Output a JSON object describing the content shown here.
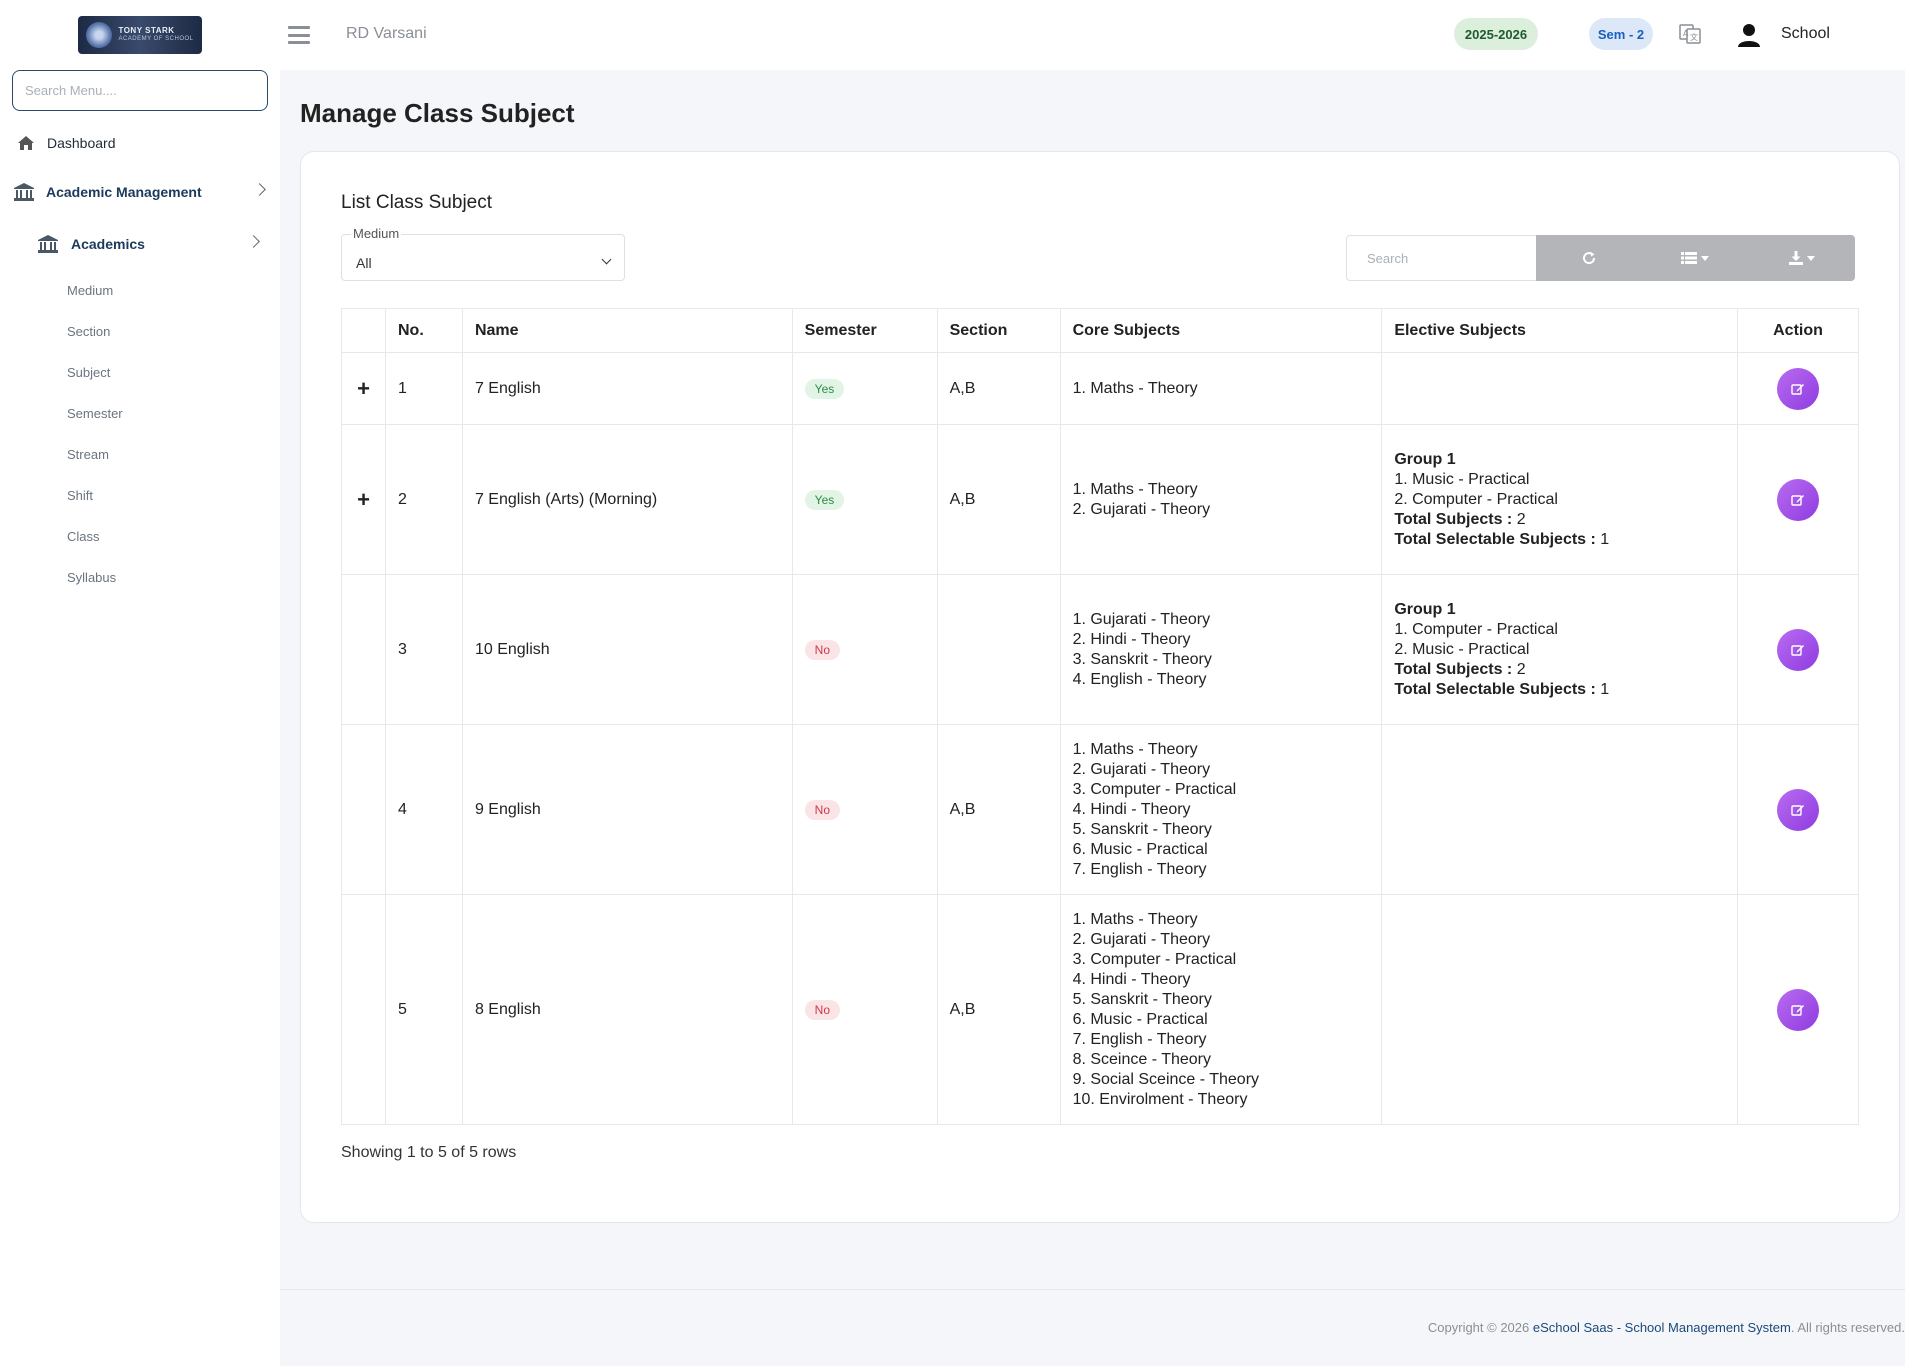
{
  "sidebar": {
    "logo_line1": "TONY STARK",
    "logo_line2": "ACADEMY OF SCHOOL",
    "search_placeholder": "Search Menu....",
    "items": [
      {
        "label": "Dashboard",
        "icon": "home-icon"
      },
      {
        "label": "Academic Management",
        "icon": "bank-icon"
      },
      {
        "label": "Academics",
        "icon": "bank-icon"
      }
    ],
    "sub_items": [
      "Medium",
      "Section",
      "Subject",
      "Semester",
      "Stream",
      "Shift",
      "Class",
      "Syllabus"
    ]
  },
  "topbar": {
    "school_name": "RD Varsani",
    "session": "2025-2026",
    "semester": "Sem - 2",
    "user_label": "School"
  },
  "page": {
    "title": "Manage Class Subject",
    "card_title": "List Class Subject",
    "medium_label": "Medium",
    "medium_value": "All",
    "search_placeholder": "Search",
    "showing": "Showing 1 to 5 of 5 rows"
  },
  "table": {
    "headers": [
      "",
      "No.",
      "Name",
      "Semester",
      "Section",
      "Core Subjects",
      "Elective Subjects",
      "Action"
    ],
    "rows": [
      {
        "expand": "+",
        "no": "1",
        "name": "7 English",
        "semester": "Yes",
        "section": "A,B",
        "core": [
          "1. Maths - Theory"
        ],
        "elective": []
      },
      {
        "expand": "+",
        "no": "2",
        "name": "7 English (Arts) (Morning)",
        "semester": "Yes",
        "section": "A,B",
        "core": [
          "1. Maths - Theory",
          "2. Gujarati - Theory"
        ],
        "elective": [
          {
            "text": "Group 1",
            "bold": true
          },
          {
            "text": "1. Music - Practical"
          },
          {
            "text": "2. Computer - Practical"
          },
          {
            "label": "Total Subjects :",
            "value": " 2"
          },
          {
            "label": "Total Selectable Subjects :",
            "value": " 1"
          }
        ]
      },
      {
        "expand": "",
        "no": "3",
        "name": "10 English",
        "semester": "No",
        "section": "",
        "core": [
          "1. Gujarati - Theory",
          "2. Hindi - Theory",
          "3. Sanskrit - Theory",
          "4. English - Theory"
        ],
        "elective": [
          {
            "text": "Group 1",
            "bold": true
          },
          {
            "text": "1. Computer - Practical"
          },
          {
            "text": "2. Music - Practical"
          },
          {
            "label": "Total Subjects :",
            "value": " 2"
          },
          {
            "label": "Total Selectable Subjects :",
            "value": " 1"
          }
        ]
      },
      {
        "expand": "",
        "no": "4",
        "name": "9 English",
        "semester": "No",
        "section": "A,B",
        "core": [
          "1. Maths - Theory",
          "2. Gujarati - Theory",
          "3. Computer - Practical",
          "4. Hindi - Theory",
          "5. Sanskrit - Theory",
          "6. Music - Practical",
          "7. English - Theory"
        ],
        "elective": []
      },
      {
        "expand": "",
        "no": "5",
        "name": "8 English",
        "semester": "No",
        "section": "A,B",
        "core": [
          "1. Maths - Theory",
          "2. Gujarati - Theory",
          "3. Computer - Practical",
          "4. Hindi - Theory",
          "5. Sanskrit - Theory",
          "6. Music - Practical",
          "7. English - Theory",
          "8. Sceince - Theory",
          "9. Social Sceince - Theory",
          "10. Envirolment - Theory"
        ],
        "elective": []
      }
    ]
  },
  "footer": {
    "prefix": "Copyright © 2026 ",
    "link": "eSchool Saas - School Management System",
    "suffix": ". All rights reserved."
  },
  "colors": {
    "accent": "#1b3a5c",
    "plus": "#1a6be0",
    "edit_button": "#a254e8",
    "yes_badge": "#2e8b45",
    "no_badge": "#d33747"
  }
}
